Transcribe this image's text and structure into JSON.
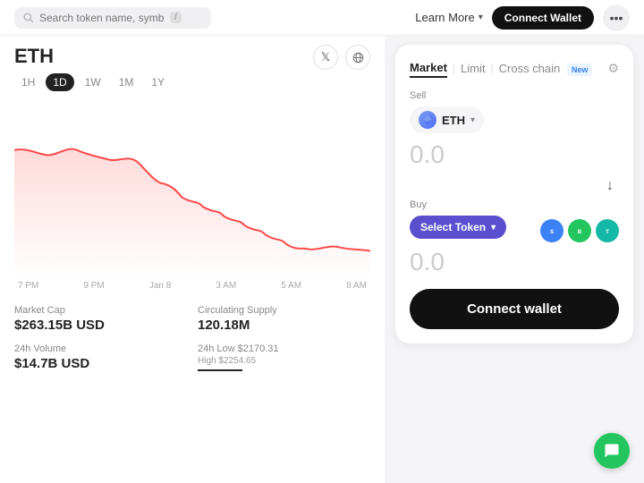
{
  "nav": {
    "search_placeholder": "Search token name, symbol or address...",
    "slash": "/",
    "learn_more": "Learn More",
    "connect_wallet": "Connect Wallet",
    "more_icon": "•••"
  },
  "token": {
    "symbol": "ETH"
  },
  "social": {
    "twitter": "𝕏",
    "globe": "🌐"
  },
  "chart": {
    "time_periods": [
      "1H",
      "1D",
      "1W",
      "1M",
      "1Y"
    ],
    "active_period": "1D",
    "x_labels": [
      "7 PM",
      "9 PM",
      "Jan 8",
      "3 AM",
      "5 AM",
      "8 AM"
    ]
  },
  "stats": {
    "market_cap_label": "Market Cap",
    "market_cap_value": "$263.15B USD",
    "supply_label": "Circulating Supply",
    "supply_value": "120.18M",
    "volume_label": "24h Volume",
    "volume_value": "$14.7B USD",
    "low_label": "24h Low $2170.31",
    "high_label": "High $2254.65"
  },
  "swap": {
    "tabs": [
      "Market",
      "Limit",
      "Cross chain"
    ],
    "active_tab": "Market",
    "new_badge": "New",
    "sell_label": "Sell",
    "sell_token": "ETH",
    "sell_amount": "0.0",
    "buy_label": "Buy",
    "select_token": "Select Token",
    "buy_amount": "0.0",
    "connect_wallet_btn": "Connect wallet",
    "settings_icon": "⚙"
  },
  "quick_tokens": [
    {
      "id": "sol",
      "label": "S"
    },
    {
      "id": "bnb",
      "label": "B"
    },
    {
      "id": "usdt",
      "label": "T"
    }
  ],
  "chat": {
    "icon": "💬"
  }
}
